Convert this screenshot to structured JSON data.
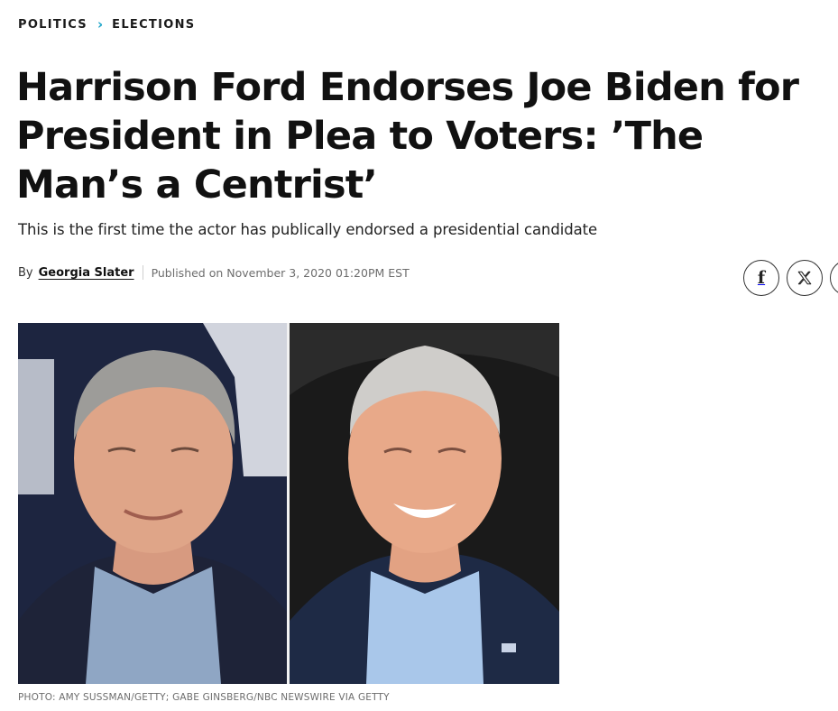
{
  "breadcrumb": {
    "items": [
      "POLITICS",
      "ELECTIONS"
    ],
    "separator": ">"
  },
  "article": {
    "headline": "Harrison Ford Endorses Joe Biden for President in Plea to Voters: ’The Man’s a Centrist’",
    "dek": "This is the first time the actor has publically endorsed a presidential candidate",
    "byline": {
      "by": "By",
      "author": "Georgia Slater",
      "published": "Published on November 3, 2020 01:20PM EST"
    },
    "photo_credit": "PHOTO: AMY SUSSMAN/GETTY; GABE GINSBERG/NBC NEWSWIRE VIA GETTY"
  },
  "share": {
    "icons": [
      "facebook-icon",
      "x-icon",
      "share-more-icon"
    ],
    "facebook_glyph": "f"
  },
  "colors": {
    "accent": "#1aa3c8",
    "text": "#111111",
    "muted": "#6d6d6d"
  }
}
